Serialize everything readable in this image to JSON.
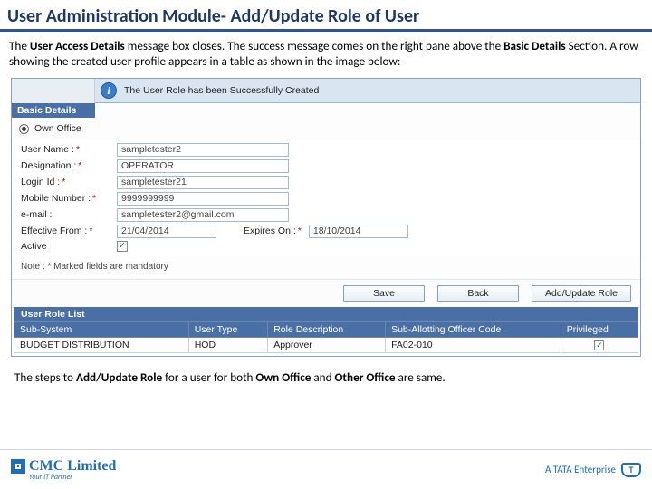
{
  "title": "User Administration Module- Add/Update Role of User",
  "intro": {
    "p1a": "The ",
    "p1b": "User Access Details",
    "p1c": " message box closes. The success message comes on the right pane above the ",
    "p1d": "Basic Details",
    "p1e": " Section. A row showing the created user profile appears in a table as shown in the image below:"
  },
  "banner": {
    "message": "The User Role has been Successfully Created"
  },
  "section": {
    "basic": "Basic Details"
  },
  "radio": {
    "own": "Own Office"
  },
  "form": {
    "username_l": "User Name :",
    "username_v": "sampletester2",
    "designation_l": "Designation :",
    "designation_v": "OPERATOR",
    "loginid_l": "Login Id :",
    "loginid_v": "sampletester21",
    "mobile_l": "Mobile Number :",
    "mobile_v": "9999999999",
    "email_l": "e-mail :",
    "email_v": "sampletester2@gmail.com",
    "eff_l": "Effective From :",
    "eff_v": "21/04/2014",
    "exp_l": "Expires On :",
    "exp_v": "18/10/2014",
    "active_l": "Active"
  },
  "note": "Note : * Marked fields are mandatory",
  "buttons": {
    "save": "Save",
    "back": "Back",
    "addrole": "Add/Update Role"
  },
  "urlist": {
    "title": "User Role List",
    "cols": {
      "sub": "Sub-System",
      "utype": "User Type",
      "rdesc": "Role Description",
      "sall": "Sub-Allotting Officer Code",
      "priv": "Privileged"
    },
    "row": {
      "sub": "BUDGET DISTRIBUTION",
      "utype": "HOD",
      "rdesc": "Approver",
      "sall": "FA02-010"
    }
  },
  "outro": {
    "a": "The steps to ",
    "b": "Add/Update Role",
    "c": " for a user for both ",
    "d": "Own Office",
    "e": " and ",
    "f": "Other Office",
    "g": " are same."
  },
  "footer": {
    "cmc": "CMC Limited",
    "cmc_tag": "Your IT Partner",
    "tata": "A TATA Enterprise"
  }
}
